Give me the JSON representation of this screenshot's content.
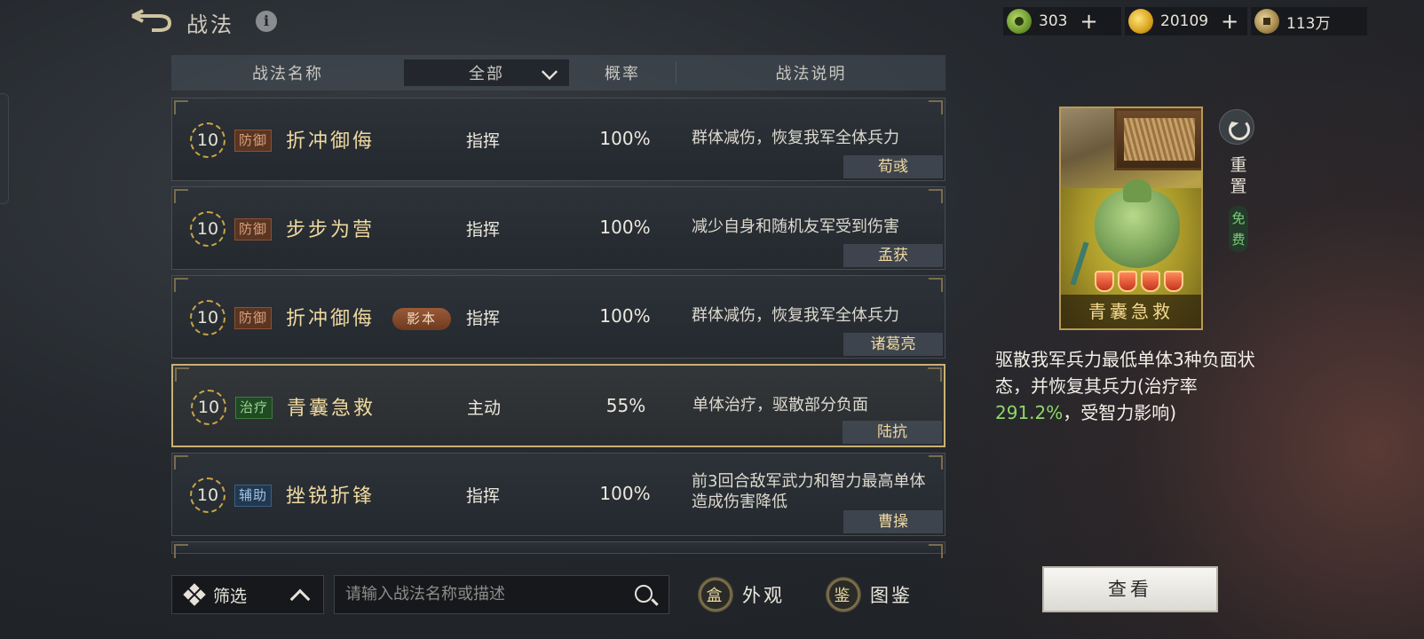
{
  "header": {
    "title": "战法",
    "info_glyph": "i"
  },
  "currencies": [
    {
      "icon": "jade-coin-icon",
      "value": "303",
      "plus": "+"
    },
    {
      "icon": "gold-coin-icon",
      "value": "20109",
      "plus": "+"
    },
    {
      "icon": "copper-coin-icon",
      "value": "113万"
    }
  ],
  "table": {
    "col_name": "战法名称",
    "filter_value": "全部",
    "col_rate": "概率",
    "col_desc": "战法说明"
  },
  "rows": [
    {
      "level": "10",
      "tag": "防御",
      "name": "折冲御侮",
      "badge": "",
      "kind": "指挥",
      "rate": "100%",
      "desc": "群体减伤，恢复我军全体兵力",
      "general": "荀彧"
    },
    {
      "level": "10",
      "tag": "防御",
      "name": "步步为营",
      "badge": "",
      "kind": "指挥",
      "rate": "100%",
      "desc": "减少自身和随机友军受到伤害",
      "general": "孟获"
    },
    {
      "level": "10",
      "tag": "防御",
      "name": "折冲御侮",
      "badge": "影本",
      "kind": "指挥",
      "rate": "100%",
      "desc": "群体减伤，恢复我军全体兵力",
      "general": "诸葛亮"
    },
    {
      "level": "10",
      "tag": "治疗",
      "name": "青囊急救",
      "badge": "",
      "kind": "主动",
      "rate": "55%",
      "desc": "单体治疗，驱散部分负面",
      "general": "陆抗"
    },
    {
      "level": "10",
      "tag": "辅助",
      "name": "挫锐折锋",
      "badge": "",
      "kind": "指挥",
      "rate": "100%",
      "desc": "前3回合敌军武力和智力最高单体造成伤害降低",
      "general": "曹操"
    }
  ],
  "bottom": {
    "filter_label": "筛选",
    "search_placeholder": "请输入战法名称或描述",
    "look_label": "外观",
    "look_icon_char": "盒",
    "codex_label": "图鉴",
    "codex_icon_char": "鉴"
  },
  "panel": {
    "card_title": "青囊急救",
    "reset_label": "重置",
    "free_label": "免费",
    "detail_prefix": "驱散我军兵力最低单体3种负面状态，并恢复其兵力(治疗率",
    "detail_highlight": "291.2%",
    "detail_suffix": "，受智力影响)",
    "view_button": "查看"
  },
  "colors": {
    "accent_gold": "#f0d9a0",
    "heal_green": "#8bd96a",
    "selected_border": "#c9b172"
  }
}
